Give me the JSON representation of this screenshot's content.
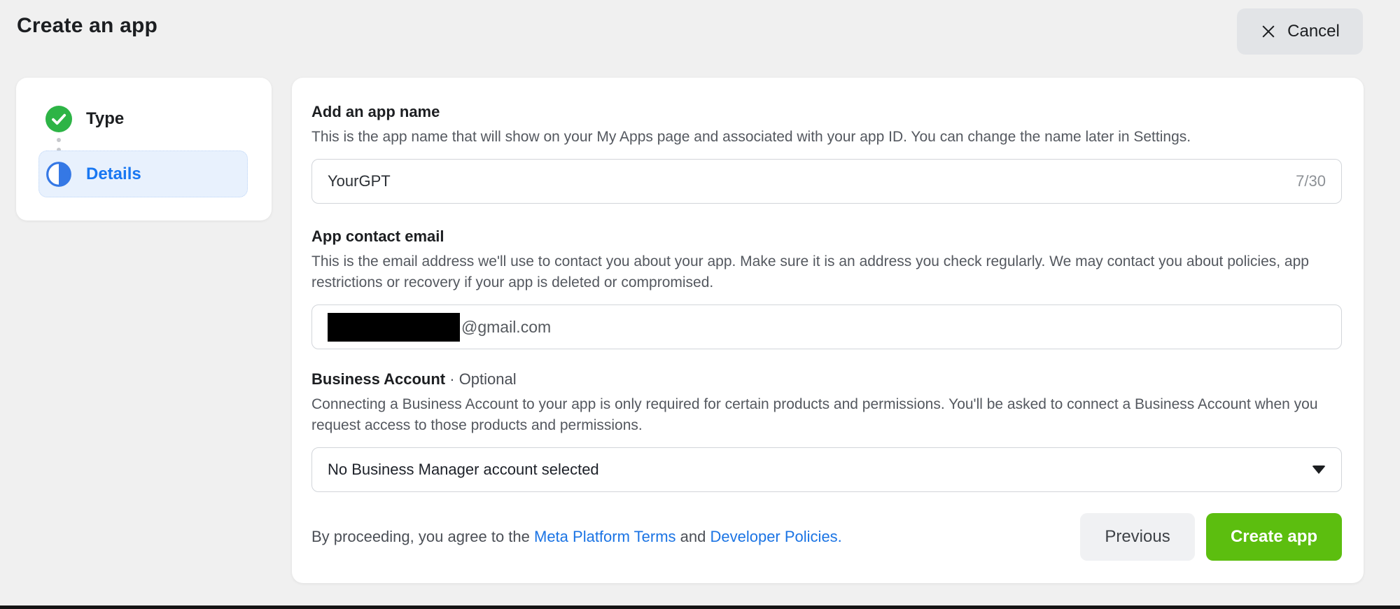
{
  "page": {
    "title": "Create an app"
  },
  "header": {
    "cancel_label": "Cancel",
    "cancel_icon": "close-icon"
  },
  "stepper": {
    "steps": [
      {
        "label": "Type",
        "state": "complete",
        "icon": "check-circle-icon"
      },
      {
        "label": "Details",
        "state": "current",
        "icon": "half-filled-circle-icon"
      }
    ]
  },
  "form": {
    "app_name": {
      "heading": "Add an app name",
      "description": "This is the app name that will show on your My Apps page and associated with your app ID. You can change the name later in Settings.",
      "value": "YourGPT",
      "char_counter": "7/30"
    },
    "contact_email": {
      "heading": "App contact email",
      "description": "This is the email address we'll use to contact you about your app. Make sure it is an address you check regularly. We may contact you about policies, app restrictions or recovery if your app is deleted or compromised.",
      "value_visible": "@gmail.com",
      "value_redacted": true
    },
    "business_account": {
      "heading": "Business Account",
      "optional_label": "· Optional",
      "description": "Connecting a Business Account to your app is only required for certain products and permissions. You'll be asked to connect a Business Account when you request access to those products and permissions.",
      "selected_value": "No Business Manager account selected",
      "dropdown_icon": "caret-down-icon"
    }
  },
  "footer": {
    "agreement_prefix": "By proceeding, you agree to the ",
    "terms_link_label": "Meta Platform Terms",
    "agreement_middle": " and ",
    "policies_link_label": "Developer Policies.",
    "previous_label": "Previous",
    "create_label": "Create app"
  },
  "colors": {
    "page_background": "#f0f0f0",
    "card_background": "#ffffff",
    "step_complete_green": "#2db446",
    "step_current_blue": "#1877f2",
    "step_icon_blue": "#3578e5",
    "step_highlight_blue": "#e8f1fd",
    "link_blue": "#1b74e4",
    "create_button_green": "#5cbe0f",
    "cancel_button_gray": "#e2e4e7",
    "input_border": "#d2d5da",
    "text_primary": "#1c1e21",
    "text_secondary": "#54585f"
  }
}
